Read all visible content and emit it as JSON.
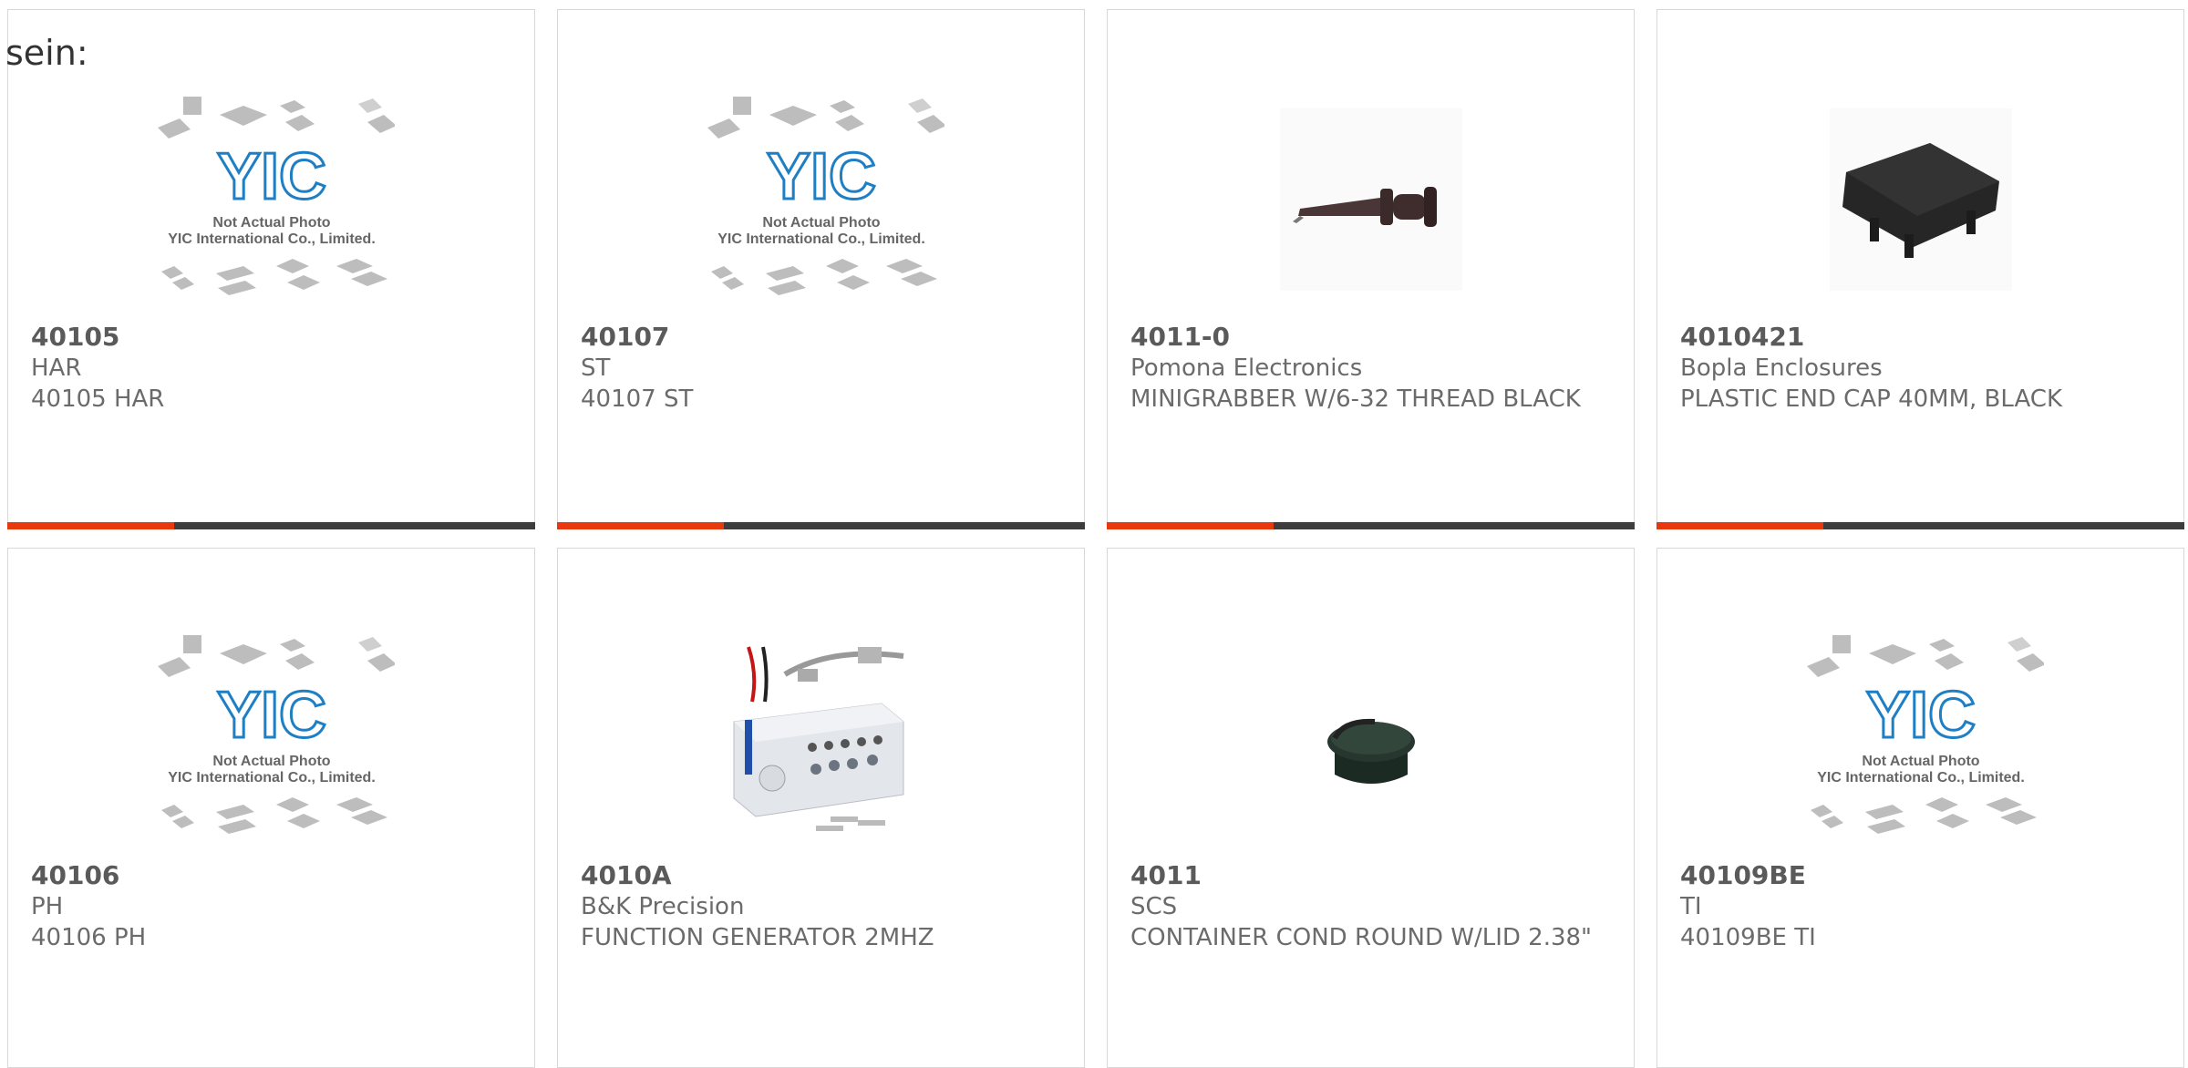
{
  "lead_text": "sein:",
  "colors": {
    "accent": "#e8380d",
    "bar": "#3d3d3d",
    "border": "#d8d8d8",
    "logo": "#1e7fc4"
  },
  "placeholder": {
    "logo_text": "YIC",
    "caption_line1": "Not Actual Photo",
    "caption_line2": "YIC International Co., Limited."
  },
  "products": [
    {
      "part": "40105",
      "manufacturer": "HAR",
      "description": "40105 HAR",
      "image": "placeholder"
    },
    {
      "part": "40107",
      "manufacturer": "ST",
      "description": "40107 ST",
      "image": "placeholder"
    },
    {
      "part": "4011-0",
      "manufacturer": "Pomona Electronics",
      "description": "MINIGRABBER W/6-32 THREAD BLACK",
      "image": "minigrabber-clip-photo"
    },
    {
      "part": "4010421",
      "manufacturer": "Bopla Enclosures",
      "description": "PLASTIC END CAP 40MM, BLACK",
      "image": "end-cap-photo"
    },
    {
      "part": "40106",
      "manufacturer": "PH",
      "description": "40106 PH",
      "image": "placeholder"
    },
    {
      "part": "4010A",
      "manufacturer": "B&K Precision",
      "description": "FUNCTION GENERATOR 2MHZ",
      "image": "function-generator-photo"
    },
    {
      "part": "4011",
      "manufacturer": "SCS",
      "description": "CONTAINER COND ROUND W/LID 2.38\"",
      "image": "container-photo"
    },
    {
      "part": "40109BE",
      "manufacturer": "TI",
      "description": "40109BE TI",
      "image": "placeholder"
    }
  ]
}
